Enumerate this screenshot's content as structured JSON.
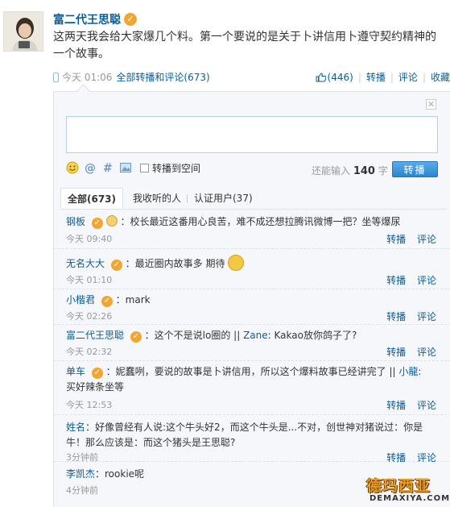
{
  "post": {
    "author": "富二代王思聪",
    "text": "这两天我会给大家爆几个料。第一个要说的是关于卜讲信用卜遵守契约精神的一个故事。",
    "time": "今天 01:06",
    "all_reposts_label": "全部转播和评论",
    "all_reposts_count": "(673)",
    "likes": "(446)",
    "repost_label": "转播",
    "comment_label": "评论",
    "favorite_label": "收藏"
  },
  "reply_box": {
    "close": "✕",
    "repost_to_space": "转播到空间",
    "char_prefix": "还能输入",
    "char_count": "140",
    "char_suffix": "字",
    "submit": "转播"
  },
  "tabs": {
    "all": "全部(673)",
    "following": "我收听的人",
    "verified": "认证用户(37)"
  },
  "actions": {
    "repost": "转播",
    "comment": "评论"
  },
  "comments": [
    {
      "name": "钢板",
      "text": "：校长最近这番用心良苦，难不成还想拉腾讯微博一把？坐等爆尿",
      "time": "今天 09:40"
    },
    {
      "name": "无名大大",
      "text": "：最近圈内故事多 期待",
      "time": "今天 01:10"
    },
    {
      "name": "小楷君",
      "text": "：mark",
      "time": "今天 02:26"
    },
    {
      "name": "富二代王思聪",
      "text": "：这个不是说lo圈的 || ",
      "mention": "Zane",
      "text2": ": Kakao放你鸽子了?",
      "time": "今天 02:32"
    },
    {
      "name": "单车",
      "text": "：妮蠢咧，要说的故事是卜讲信用，所以这个爆料故事已经讲完了 || ",
      "mention": "小龍",
      "text2": ": 买好辣条坐等",
      "time": "今天 12:53"
    },
    {
      "name": "姓名",
      "text": "：好像曾经有人说:这个牛头好2，而这个牛头是...不对，创世神对猪说过：你是牛！那么应该是：而这个猪头是王思聪?",
      "time": "3分钟前"
    },
    {
      "name": "李凯杰",
      "text": "：rookie呢",
      "time": "4分钟前"
    }
  ],
  "watermark": {
    "title": "德玛西亚",
    "subtitle": "DEMAXIYA.COM"
  },
  "colors": {
    "link": "#0a5d99",
    "badge": "#f3a531",
    "panel_bg": "#f5f7fa",
    "button": "#2a86cf"
  }
}
